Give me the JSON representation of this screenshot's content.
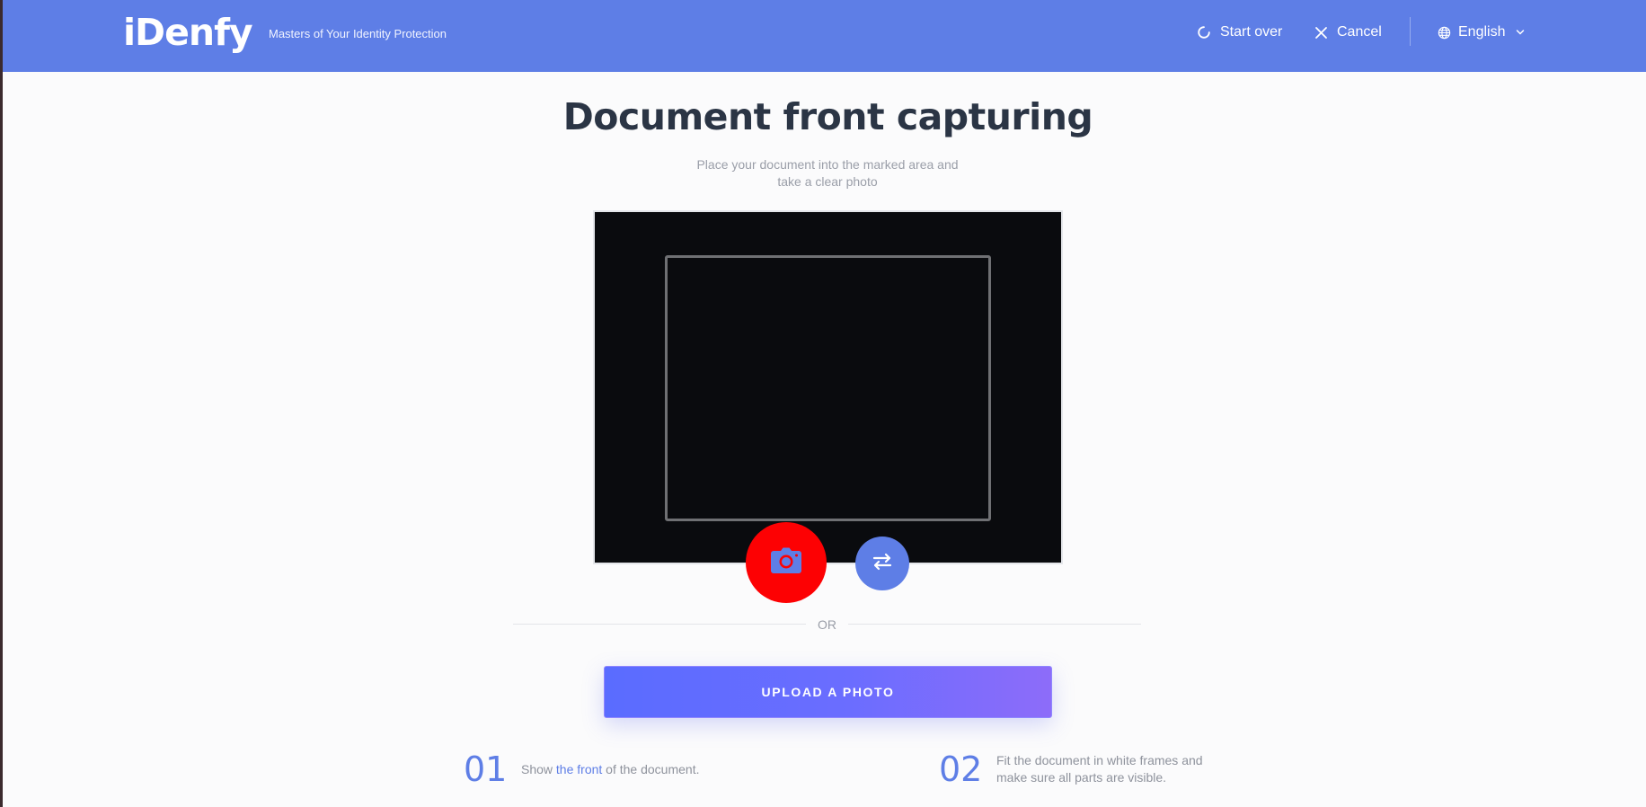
{
  "header": {
    "logo": "iDenfy",
    "tagline": "Masters of Your Identity Protection",
    "start_over_label": "Start over",
    "cancel_label": "Cancel",
    "language_label": "English",
    "bg_color": "#5e7ee6"
  },
  "main": {
    "title": "Document front capturing",
    "subtitle": "Place your document into the marked area and take a clear photo",
    "or_label": "OR",
    "upload_label": "UPLOAD A PHOTO",
    "capture_button_color": "#fd0103",
    "capture_icon": "camera-icon",
    "switch_icon": "switch-camera-icon"
  },
  "steps": [
    {
      "number": "01",
      "text_before": "Show ",
      "link_text": "the front",
      "text_after": " of the document."
    },
    {
      "number": "02",
      "text": "Fit the document in white frames and make sure all parts are visible."
    }
  ]
}
